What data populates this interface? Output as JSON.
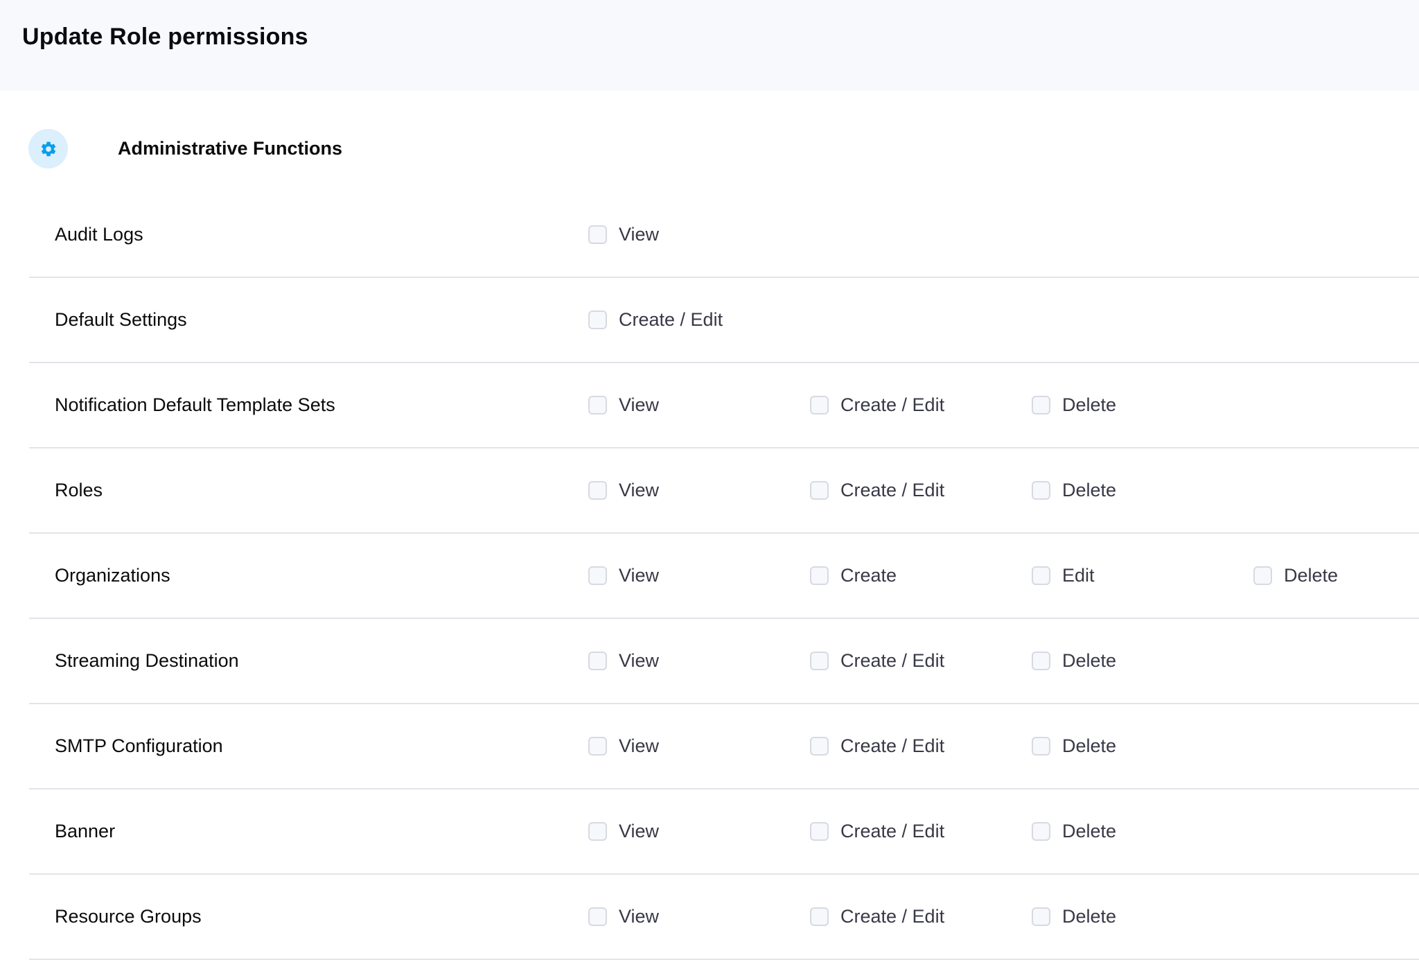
{
  "header": {
    "title": "Update Role permissions"
  },
  "section": {
    "title": "Administrative Functions",
    "icon": "gear-icon",
    "icon_color": "#0a9eeb",
    "icon_bg": "#dbeffc"
  },
  "rows": [
    {
      "label": "Audit Logs",
      "permissions": [
        {
          "label": "View",
          "checked": false
        }
      ]
    },
    {
      "label": "Default Settings",
      "permissions": [
        {
          "label": "Create / Edit",
          "checked": false
        }
      ]
    },
    {
      "label": "Notification Default Template Sets",
      "permissions": [
        {
          "label": "View",
          "checked": false
        },
        {
          "label": "Create / Edit",
          "checked": false
        },
        {
          "label": "Delete",
          "checked": false
        }
      ]
    },
    {
      "label": "Roles",
      "permissions": [
        {
          "label": "View",
          "checked": false
        },
        {
          "label": "Create / Edit",
          "checked": false
        },
        {
          "label": "Delete",
          "checked": false
        }
      ]
    },
    {
      "label": "Organizations",
      "permissions": [
        {
          "label": "View",
          "checked": false
        },
        {
          "label": "Create",
          "checked": false
        },
        {
          "label": "Edit",
          "checked": false
        },
        {
          "label": "Delete",
          "checked": false
        }
      ]
    },
    {
      "label": "Streaming Destination",
      "permissions": [
        {
          "label": "View",
          "checked": false
        },
        {
          "label": "Create / Edit",
          "checked": false
        },
        {
          "label": "Delete",
          "checked": false
        }
      ]
    },
    {
      "label": "SMTP Configuration",
      "permissions": [
        {
          "label": "View",
          "checked": false
        },
        {
          "label": "Create / Edit",
          "checked": false
        },
        {
          "label": "Delete",
          "checked": false
        }
      ]
    },
    {
      "label": "Banner",
      "permissions": [
        {
          "label": "View",
          "checked": false
        },
        {
          "label": "Create / Edit",
          "checked": false
        },
        {
          "label": "Delete",
          "checked": false
        }
      ]
    },
    {
      "label": "Resource Groups",
      "permissions": [
        {
          "label": "View",
          "checked": false
        },
        {
          "label": "Create / Edit",
          "checked": false
        },
        {
          "label": "Delete",
          "checked": false
        }
      ]
    }
  ]
}
